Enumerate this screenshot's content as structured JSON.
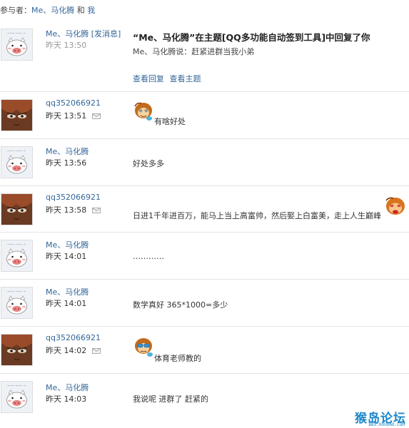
{
  "participants": {
    "label": "参与者：",
    "names": [
      "Me、马化腾",
      "我"
    ],
    "joiner": "和"
  },
  "notice": {
    "user": "Me、马化腾",
    "tag": "[发消息]",
    "time": "昨天 13:50",
    "title": "“Me、马化腾”在主题[QQ多功能自动签到工具]中回复了你",
    "subtitle": "Me、马化腾说：赶紧进群当我小弟",
    "link_view_reply": "查看回复",
    "link_view_topic": "查看主题"
  },
  "messages": [
    {
      "user": "qq352066921",
      "time": "昨天 13:51",
      "text": "有啥好处",
      "avatar": "face",
      "emoji": "monkey-icon"
    },
    {
      "user": "Me、马化腾",
      "time": "昨天 13:56",
      "text": "好处多多",
      "avatar": "pig"
    },
    {
      "user": "qq352066921",
      "time": "昨天 13:58",
      "text": "日进1千年进百万，能马上当上高富帅，然后娶上白富美，走上人生巅峰",
      "avatar": "face",
      "emoji": "monkey-icon"
    },
    {
      "user": "Me、马化腾",
      "time": "昨天 14:01",
      "text": "…………",
      "avatar": "pig"
    },
    {
      "user": "Me、马化腾",
      "time": "昨天 14:01",
      "text": "数学真好  365*1000=多少",
      "avatar": "pig"
    },
    {
      "user": "qq352066921",
      "time": "昨天 14:02",
      "text": "体育老师教的",
      "avatar": "face",
      "emoji": "monkey-icon"
    },
    {
      "user": "Me、马化腾",
      "time": "昨天 14:03",
      "text": "我说呢 进群了 赶紧的",
      "avatar": "pig"
    }
  ],
  "watermark": {
    "main": "猴岛论坛",
    "sub": "BBS.HOUDAO.COM"
  },
  "colors": {
    "link": "#336699",
    "divider": "#e4e4e4",
    "watermark": "#1a86c8"
  }
}
